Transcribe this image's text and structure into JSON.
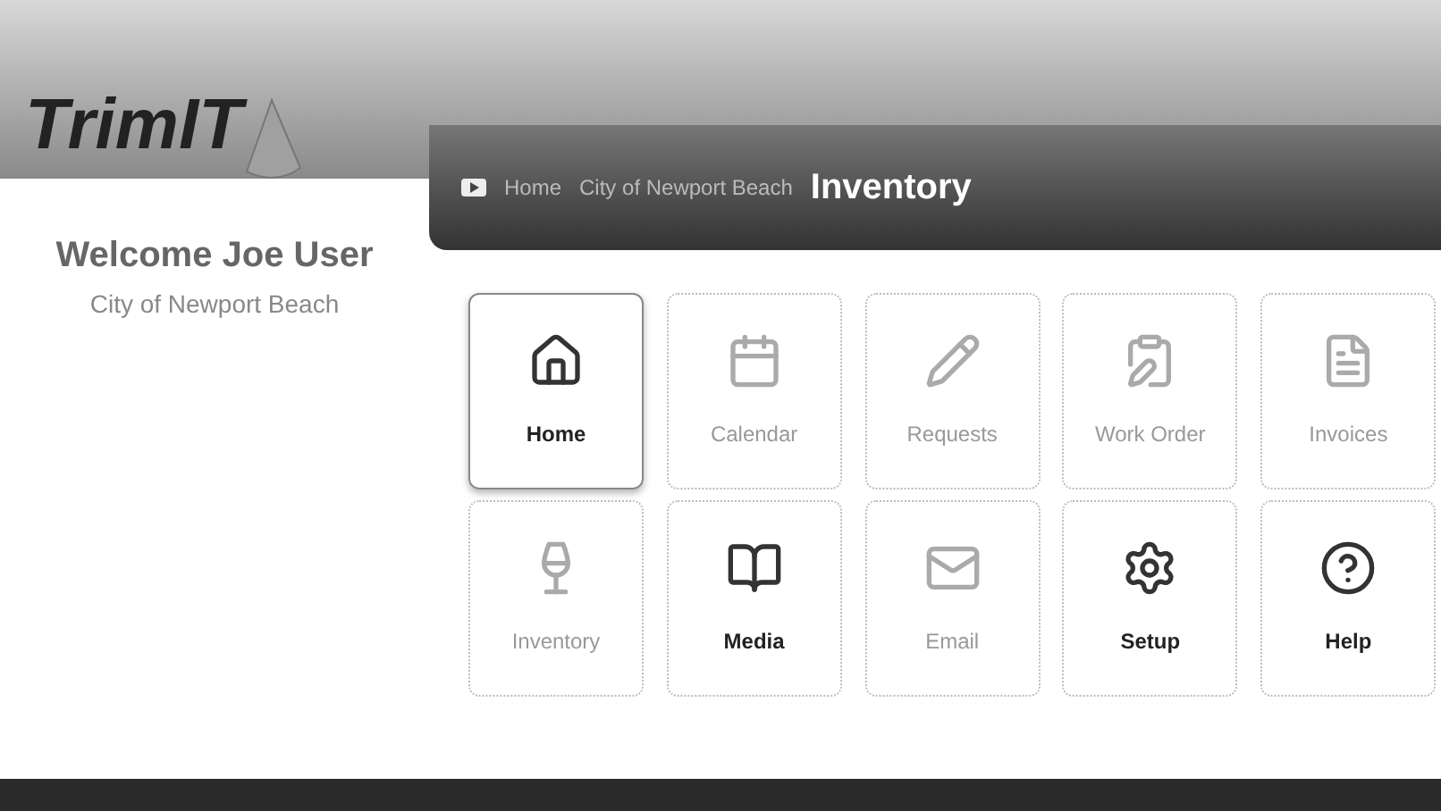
{
  "logo": {
    "text": "TrimIT"
  },
  "breadcrumb": {
    "items": [
      "Home",
      "City of Newport Beach"
    ],
    "current": "Inventory"
  },
  "welcome": {
    "title": "Welcome Joe User",
    "subtitle": "City of Newport Beach"
  },
  "tiles": [
    {
      "label": "Home",
      "active": true,
      "selected": true
    },
    {
      "label": "Calendar",
      "active": false,
      "selected": false
    },
    {
      "label": "Requests",
      "active": false,
      "selected": false
    },
    {
      "label": "Work Order",
      "active": false,
      "selected": false
    },
    {
      "label": "Invoices",
      "active": false,
      "selected": false
    },
    {
      "label": "Inventory",
      "active": false,
      "selected": false
    },
    {
      "label": "Media",
      "active": true,
      "selected": false
    },
    {
      "label": "Email",
      "active": false,
      "selected": false
    },
    {
      "label": "Setup",
      "active": true,
      "selected": false
    },
    {
      "label": "Help",
      "active": true,
      "selected": false
    }
  ]
}
